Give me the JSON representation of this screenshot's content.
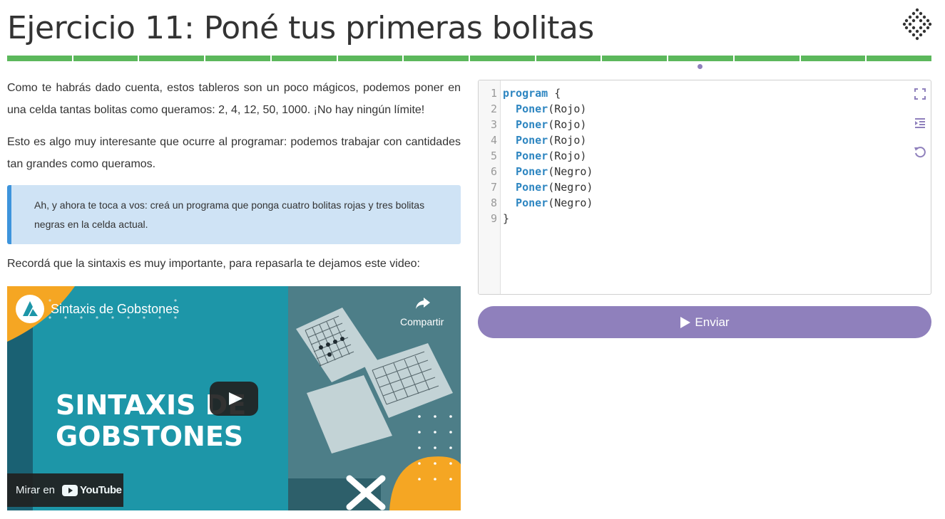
{
  "header": {
    "title": "Ejercicio 11: Poné tus primeras bolitas",
    "progress_total": 14,
    "progress_current": 11
  },
  "content": {
    "paragraph1": "Como te habrás dado cuenta, estos tableros son un poco mágicos, podemos poner en una celda tantas bolitas como queramos: 2, 4, 12, 50, 1000. ¡No hay ningún límite!",
    "paragraph2": "Esto es algo muy interesante que ocurre al programar: podemos trabajar con cantidades tan grandes como queramos.",
    "callout": "Ah, y ahora te toca a vos: creá un programa que ponga cuatro bolitas rojas y tres bolitas negras en la celda actual.",
    "paragraph3": "Recordá que la sintaxis es muy importante, para repasarla te dejamos este video:"
  },
  "video": {
    "channel_title": "Sintaxis de Gobstones",
    "share_label": "Compartir",
    "thumbnail_line1": "SINTAXIS DE",
    "thumbnail_line2": "GOBSTONES",
    "watch_on": "Mirar en",
    "youtube_label": "YouTube"
  },
  "editor": {
    "lines": [
      {
        "n": "1",
        "kw": "program",
        "rest": " {"
      },
      {
        "n": "2",
        "kw": "  Poner",
        "rest": "(Rojo)"
      },
      {
        "n": "3",
        "kw": "  Poner",
        "rest": "(Rojo)"
      },
      {
        "n": "4",
        "kw": "  Poner",
        "rest": "(Rojo)"
      },
      {
        "n": "5",
        "kw": "  Poner",
        "rest": "(Rojo)"
      },
      {
        "n": "6",
        "kw": "  Poner",
        "rest": "(Negro)"
      },
      {
        "n": "7",
        "kw": "  Poner",
        "rest": "(Negro)"
      },
      {
        "n": "8",
        "kw": "  Poner",
        "rest": "(Negro)"
      },
      {
        "n": "9",
        "kw": "",
        "rest": "}"
      }
    ],
    "icons": [
      "fullscreen-icon",
      "indent-icon",
      "reset-icon"
    ]
  },
  "actions": {
    "submit_label": "Enviar"
  },
  "colors": {
    "progress": "#5cb85c",
    "accent": "#8f80bc",
    "callout_bg": "#cfe3f5",
    "callout_border": "#3d94dc",
    "keyword": "#2e86c1"
  }
}
